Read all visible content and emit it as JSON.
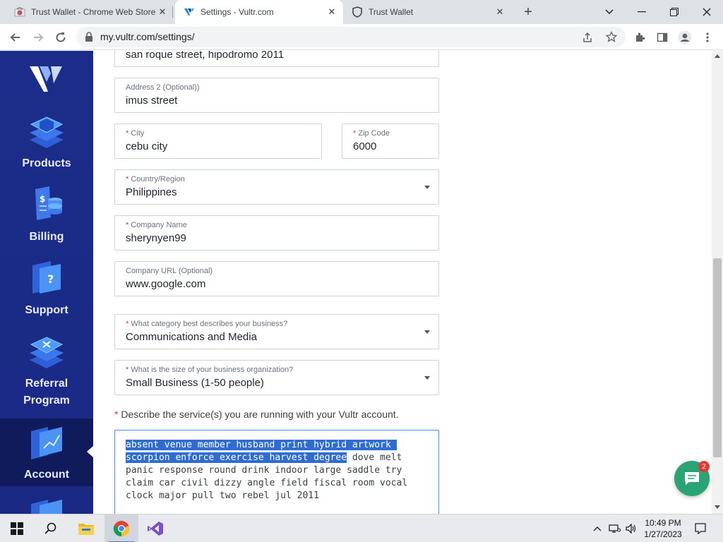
{
  "browser": {
    "tabs": [
      {
        "title": "Trust Wallet - Chrome Web Store",
        "favicon": "chrome-web-store-icon"
      },
      {
        "title": "Settings - Vultr.com",
        "favicon": "vultr-icon"
      },
      {
        "title": "Trust Wallet",
        "favicon": "shield-icon"
      }
    ],
    "url": "my.vultr.com/settings/"
  },
  "sidebar": {
    "items": [
      {
        "label": "Products",
        "icon": "products-icon"
      },
      {
        "label": "Billing",
        "icon": "billing-icon"
      },
      {
        "label": "Support",
        "icon": "support-icon"
      },
      {
        "label": "Referral Program",
        "icon": "referral-icon"
      },
      {
        "label": "Account",
        "icon": "account-icon",
        "active": true
      }
    ]
  },
  "form": {
    "address1": {
      "value": "san roque street, hipodromo 2011"
    },
    "address2": {
      "label": "Address 2 (Optional))",
      "value": "imus street"
    },
    "city": {
      "label": "City",
      "value": "cebu city"
    },
    "zip": {
      "label": "Zip Code",
      "value": "6000"
    },
    "country": {
      "label": "Country/Region",
      "value": "Philippines"
    },
    "company_name": {
      "label": "Company Name",
      "value": "sherynyen99"
    },
    "company_url": {
      "label": "Company URL (Optional)",
      "value": "www.google.com"
    },
    "category": {
      "label": "What category best describes your business?",
      "value": "Communications and Media"
    },
    "size": {
      "label": "What is the size of your business organization?",
      "value": "Small Business (1-50 people)"
    },
    "describe": {
      "label": "Describe the service(s) you are running with your Vultr account.",
      "selected_text": "absent venue member husband print hybrid artwork \nscorpion enforce exercise harvest degree",
      "rest_text": " dove melt\npanic response round drink indoor large saddle try\nclaim car civil dizzy angle field fiscal room vocal\nclock major pull two rebel jul 2011"
    }
  },
  "chat": {
    "badge": "2"
  },
  "taskbar": {
    "time": "10:49 PM",
    "date": "1/27/2023"
  },
  "colors": {
    "sidebar": "#1b2c8a",
    "accent_selection": "#2f6cd1",
    "chat": "#2aa475"
  }
}
